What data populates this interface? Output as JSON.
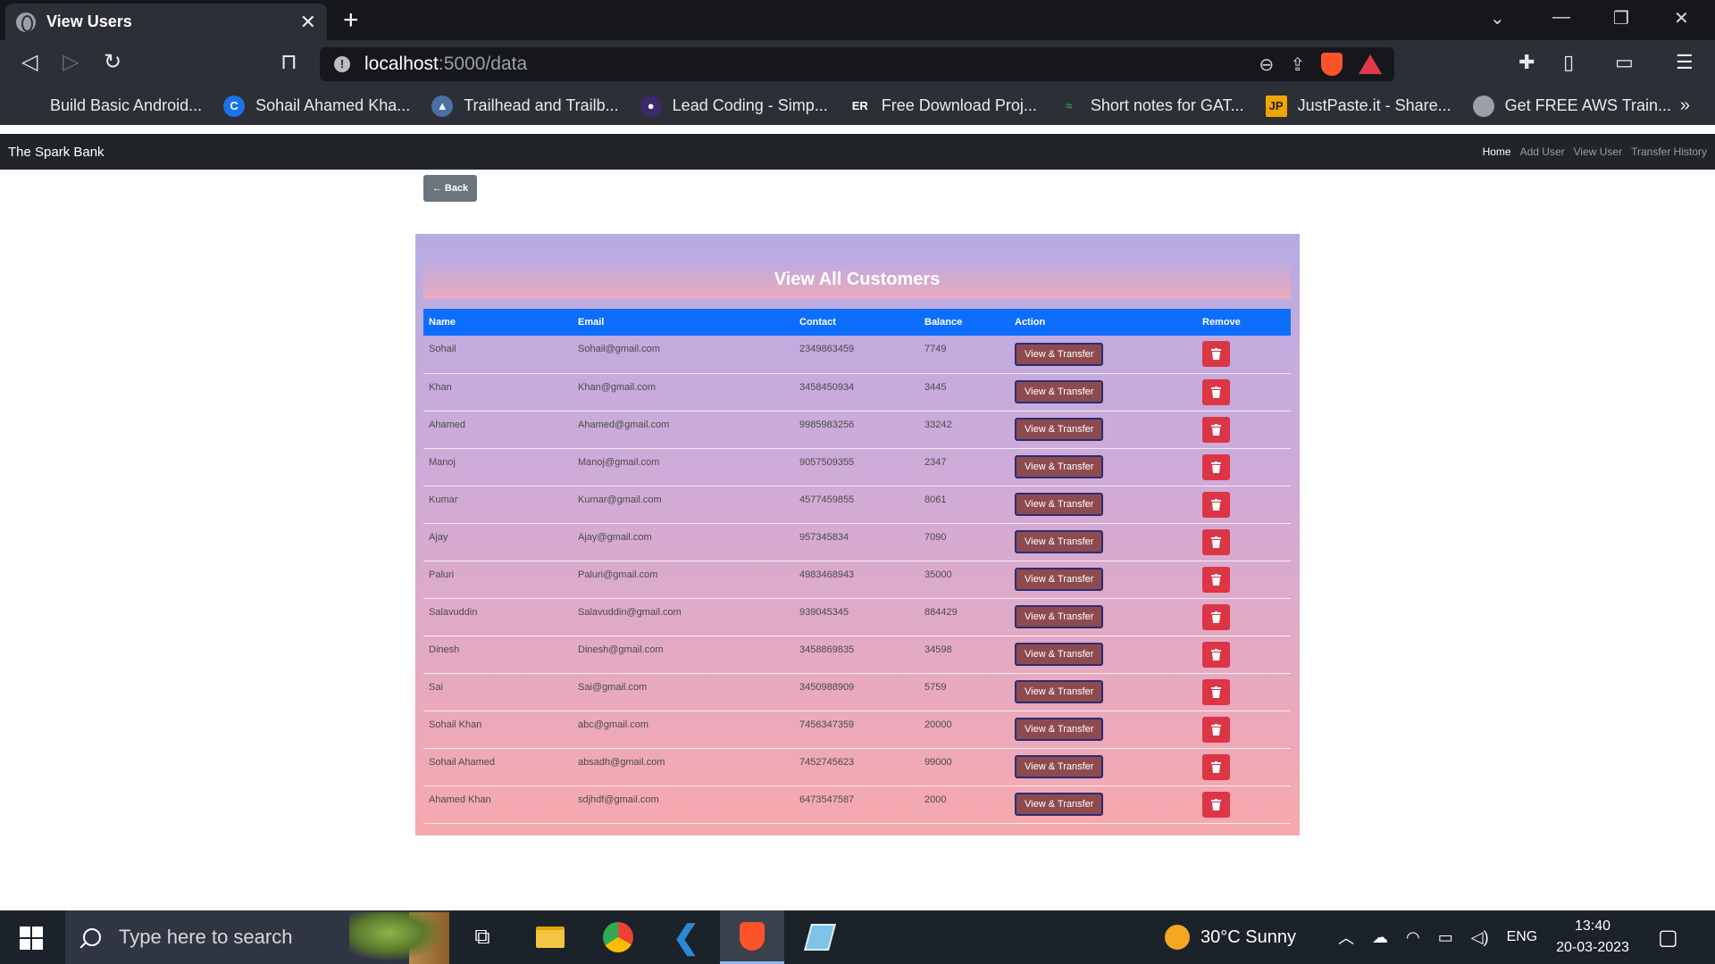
{
  "browser": {
    "tab_title": "View Users",
    "tab_close": "✕",
    "new_tab": "+",
    "url_host": "localhost",
    "url_path": ":5000/data",
    "bookmarks": [
      {
        "label": "Build Basic Android...",
        "color": "#2d2f36"
      },
      {
        "label": "Sohail Ahamed Kha...",
        "color": "#1a73e8"
      },
      {
        "label": "Trailhead and Trailb...",
        "color": "#4a6fa5"
      },
      {
        "label": "Lead Coding - Simp...",
        "color": "#3b2a6b"
      },
      {
        "label": "Free Download Proj...",
        "color": "#2d2f36"
      },
      {
        "label": "Short notes for GAT...",
        "color": "#2f9e44"
      },
      {
        "label": "JustPaste.it - Share...",
        "color": "#f0a500"
      },
      {
        "label": "Get FREE AWS Train...",
        "color": "#9aa0a6"
      }
    ],
    "bookmarks_more": "»"
  },
  "site": {
    "brand": "The Spark Bank",
    "nav": [
      "Home",
      "Add User",
      "View User",
      "Transfer History"
    ],
    "back_label": "← Back",
    "heading": "View All Customers",
    "columns": [
      "Name",
      "Email",
      "Contact",
      "Balance",
      "Action",
      "Remove"
    ],
    "action_label": "View & Transfer",
    "customers": [
      {
        "name": "Sohail",
        "email": "Sohail@gmail.com",
        "contact": "2349863459",
        "balance": "7749"
      },
      {
        "name": "Khan",
        "email": "Khan@gmail.com",
        "contact": "3458450934",
        "balance": "3445"
      },
      {
        "name": "Ahamed",
        "email": "Ahamed@gmail.com",
        "contact": "9985983256",
        "balance": "33242"
      },
      {
        "name": "Manoj",
        "email": "Manoj@gmail.com",
        "contact": "9057509355",
        "balance": "2347"
      },
      {
        "name": "Kumar",
        "email": "Kumar@gmail.com",
        "contact": "4577459855",
        "balance": "8061"
      },
      {
        "name": "Ajay",
        "email": "Ajay@gmail.com",
        "contact": "957345834",
        "balance": "7090"
      },
      {
        "name": "Paluri",
        "email": "Paluri@gmail.com",
        "contact": "4983468943",
        "balance": "35000"
      },
      {
        "name": "Salavuddin",
        "email": "Salavuddin@gmail.com",
        "contact": "939045345",
        "balance": "884429"
      },
      {
        "name": "Dinesh",
        "email": "Dinesh@gmail.com",
        "contact": "3458869835",
        "balance": "34598"
      },
      {
        "name": "Sai",
        "email": "Sai@gmail.com",
        "contact": "3450988909",
        "balance": "5759"
      },
      {
        "name": "Sohail Khan",
        "email": "abc@gmail.com",
        "contact": "7456347359",
        "balance": "20000"
      },
      {
        "name": "Sohail Ahamed",
        "email": "absadh@gmail.com",
        "contact": "7452745623",
        "balance": "99000"
      },
      {
        "name": "Ahamed Khan",
        "email": "sdjhdf@gmail.com",
        "contact": "6473547587",
        "balance": "2000"
      }
    ]
  },
  "taskbar": {
    "search_placeholder": "Type here to search",
    "weather": "30°C  Sunny",
    "language": "ENG",
    "time": "13:40",
    "date": "20-03-2023"
  },
  "colors": {
    "nav_bg": "#212529",
    "table_header": "#0d6efd",
    "delete_button": "#dc3545",
    "action_button": "#8e4b4f"
  }
}
